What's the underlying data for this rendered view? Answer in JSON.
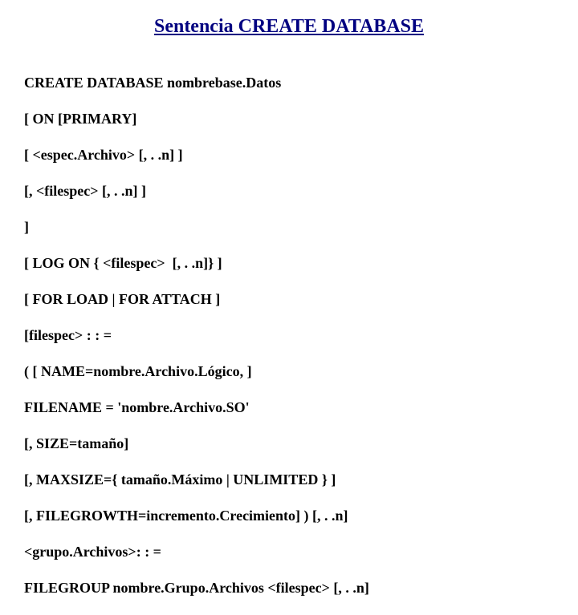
{
  "title": "Sentencia CREATE DATABASE",
  "lines": {
    "l1": "CREATE DATABASE nombrebase.Datos",
    "l2": "[ ON [PRIMARY]",
    "l3": "[ <espec.Archivo> [, . .n] ]",
    "l4": "[, <filespec> [, . .n] ]",
    "l5": "]",
    "l6": "[ LOG ON { <filespec>  [, . .n]} ]",
    "l7": "[ FOR LOAD | FOR ATTACH ]",
    "l8": "[filespec> : : =",
    "l9": "( [ NAME=nombre.Archivo.Lógico, ]",
    "l10": "FILENAME = 'nombre.Archivo.SO'",
    "l11": "[, SIZE=tamaño]",
    "l12": "[, MAXSIZE={ tamaño.Máximo | UNLIMITED } ]",
    "l13": "[, FILEGROWTH=incremento.Crecimiento] ) [, . .n]",
    "l14": "<grupo.Archivos>: : =",
    "l15": "FILEGROUP nombre.Grupo.Archivos <filespec> [, . .n]"
  }
}
